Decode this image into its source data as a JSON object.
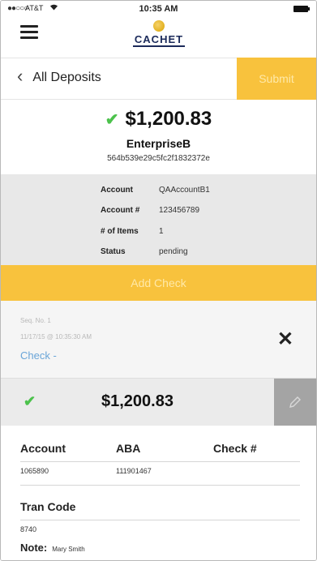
{
  "status_bar": {
    "signal": "●●○○○",
    "carrier": "AT&T",
    "wifi_icon": "wifi-icon",
    "time": "10:35 AM"
  },
  "header": {
    "logo_text": "CACHET",
    "menu_icon": "hamburger-icon"
  },
  "nav": {
    "back_label": "All Deposits",
    "submit_label": "Submit"
  },
  "deposit": {
    "amount": "$1,200.83",
    "merchant": "EnterpriseB",
    "id": "564b539e29c5fc2f1832372e",
    "details": [
      {
        "label": "Account",
        "value": "QAAccountB1"
      },
      {
        "label": "Account #",
        "value": "123456789"
      },
      {
        "label": "# of Items",
        "value": "1"
      },
      {
        "label": "Status",
        "value": "pending"
      }
    ]
  },
  "add_check_label": "Add Check",
  "check": {
    "seq": "Seq. No. 1",
    "timestamp": "11/17/15 @ 10:35:30 AM",
    "link": "Check -",
    "amount": "$1,200.83",
    "columns": [
      {
        "header": "Account",
        "value": "1065890"
      },
      {
        "header": "ABA",
        "value": "111901467"
      },
      {
        "header": "Check #",
        "value": ""
      }
    ],
    "tran_code_label": "Tran Code",
    "tran_code": "8740",
    "note_label": "Note:",
    "note_value": "Mary Smith"
  },
  "colors": {
    "accent": "#f8c23d",
    "check_green": "#4cc24c",
    "link_blue": "#6aa5d8"
  }
}
